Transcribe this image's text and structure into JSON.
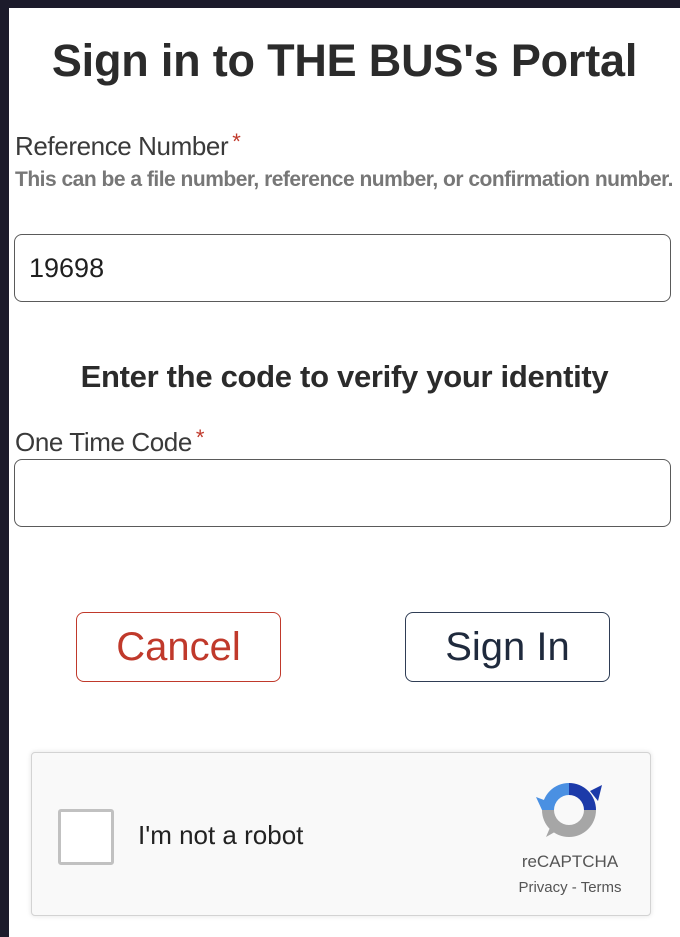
{
  "page": {
    "title": "Sign in to THE BUS's Portal"
  },
  "reference": {
    "label": "Reference Number",
    "required_mark": "*",
    "help_text": "This can be a file number, reference number, or confirmation number.",
    "value": "19698"
  },
  "verify": {
    "heading": "Enter the code to verify your identity"
  },
  "otp": {
    "label": "One Time Code",
    "required_mark": "*",
    "value": ""
  },
  "actions": {
    "cancel_label": "Cancel",
    "signin_label": "Sign In"
  },
  "recaptcha": {
    "checkbox_label": "I'm not a robot",
    "brand": "reCAPTCHA",
    "privacy_link": "Privacy",
    "separator": " - ",
    "terms_link": "Terms",
    "icon": "recaptcha-logo-icon"
  },
  "colors": {
    "page_background": "#1c1b2b",
    "required": "#c0392b",
    "cancel": "#c0392b",
    "signin_border": "#2f3d55"
  }
}
